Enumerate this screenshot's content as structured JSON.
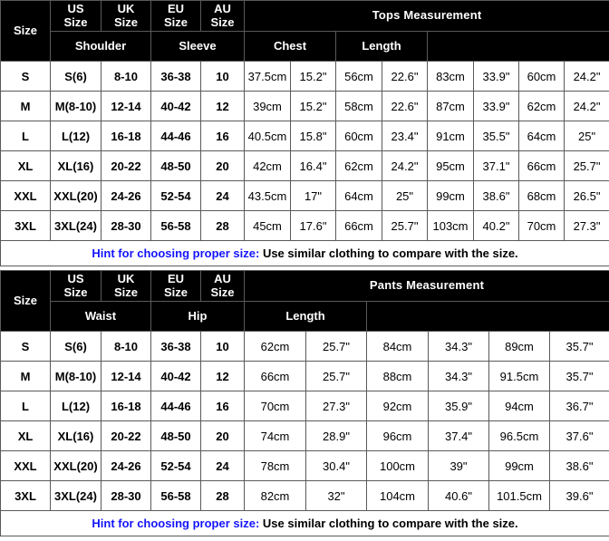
{
  "tables": [
    {
      "id": "tops",
      "measurement_title": "Tops Measurement",
      "size_headers": [
        {
          "line1": "Size",
          "line2": ""
        },
        {
          "line1": "US",
          "line2": "Size"
        },
        {
          "line1": "UK",
          "line2": "Size"
        },
        {
          "line1": "EU",
          "line2": "Size"
        },
        {
          "line1": "AU",
          "line2": "Size"
        }
      ],
      "measurement_groups": [
        "Shoulder",
        "Sleeve",
        "Chest",
        "Length"
      ],
      "rows": [
        {
          "size": "S",
          "us": "S(6)",
          "uk": "8-10",
          "eu": "36-38",
          "au": "10",
          "meas": [
            "37.5cm",
            "15.2\"",
            "56cm",
            "22.6\"",
            "83cm",
            "33.9\"",
            "60cm",
            "24.2\""
          ]
        },
        {
          "size": "M",
          "us": "M(8-10)",
          "uk": "12-14",
          "eu": "40-42",
          "au": "12",
          "meas": [
            "39cm",
            "15.2\"",
            "58cm",
            "22.6\"",
            "87cm",
            "33.9\"",
            "62cm",
            "24.2\""
          ]
        },
        {
          "size": "L",
          "us": "L(12)",
          "uk": "16-18",
          "eu": "44-46",
          "au": "16",
          "meas": [
            "40.5cm",
            "15.8\"",
            "60cm",
            "23.4\"",
            "91cm",
            "35.5\"",
            "64cm",
            "25\""
          ]
        },
        {
          "size": "XL",
          "us": "XL(16)",
          "uk": "20-22",
          "eu": "48-50",
          "au": "20",
          "meas": [
            "42cm",
            "16.4\"",
            "62cm",
            "24.2\"",
            "95cm",
            "37.1\"",
            "66cm",
            "25.7\""
          ]
        },
        {
          "size": "XXL",
          "us": "XXL(20)",
          "uk": "24-26",
          "eu": "52-54",
          "au": "24",
          "meas": [
            "43.5cm",
            "17\"",
            "64cm",
            "25\"",
            "99cm",
            "38.6\"",
            "68cm",
            "26.5\""
          ]
        },
        {
          "size": "3XL",
          "us": "3XL(24)",
          "uk": "28-30",
          "eu": "56-58",
          "au": "28",
          "meas": [
            "45cm",
            "17.6\"",
            "66cm",
            "25.7\"",
            "103cm",
            "40.2\"",
            "70cm",
            "27.3\""
          ]
        }
      ],
      "hint_lead": "Hint for choosing proper size:",
      "hint_body": " Use similar clothing to compare with the size."
    },
    {
      "id": "pants",
      "measurement_title": "Pants Measurement",
      "size_headers": [
        {
          "line1": "Size",
          "line2": ""
        },
        {
          "line1": "US",
          "line2": "Size"
        },
        {
          "line1": "UK",
          "line2": "Size"
        },
        {
          "line1": "EU",
          "line2": "Size"
        },
        {
          "line1": "AU",
          "line2": "Size"
        }
      ],
      "measurement_groups": [
        "Waist",
        "Hip",
        "Length"
      ],
      "rows": [
        {
          "size": "S",
          "us": "S(6)",
          "uk": "8-10",
          "eu": "36-38",
          "au": "10",
          "meas": [
            "62cm",
            "25.7\"",
            "84cm",
            "34.3\"",
            "89cm",
            "35.7\""
          ]
        },
        {
          "size": "M",
          "us": "M(8-10)",
          "uk": "12-14",
          "eu": "40-42",
          "au": "12",
          "meas": [
            "66cm",
            "25.7\"",
            "88cm",
            "34.3\"",
            "91.5cm",
            "35.7\""
          ]
        },
        {
          "size": "L",
          "us": "L(12)",
          "uk": "16-18",
          "eu": "44-46",
          "au": "16",
          "meas": [
            "70cm",
            "27.3\"",
            "92cm",
            "35.9\"",
            "94cm",
            "36.7\""
          ]
        },
        {
          "size": "XL",
          "us": "XL(16)",
          "uk": "20-22",
          "eu": "48-50",
          "au": "20",
          "meas": [
            "74cm",
            "28.9\"",
            "96cm",
            "37.4\"",
            "96.5cm",
            "37.6\""
          ]
        },
        {
          "size": "XXL",
          "us": "XXL(20)",
          "uk": "24-26",
          "eu": "52-54",
          "au": "24",
          "meas": [
            "78cm",
            "30.4\"",
            "100cm",
            "39\"",
            "99cm",
            "38.6\""
          ]
        },
        {
          "size": "3XL",
          "us": "3XL(24)",
          "uk": "28-30",
          "eu": "56-58",
          "au": "28",
          "meas": [
            "82cm",
            "32\"",
            "104cm",
            "40.6\"",
            "101.5cm",
            "39.6\""
          ]
        }
      ],
      "hint_lead": "Hint for choosing proper size:",
      "hint_body": " Use similar clothing to compare with the size."
    }
  ],
  "colors": {
    "header_bg": "#000000",
    "header_text": "#ffffff",
    "cell_bg": "#ffffff",
    "cell_text": "#000000",
    "hint_accent": "#1414ff",
    "grid": "#5a5a5a"
  }
}
